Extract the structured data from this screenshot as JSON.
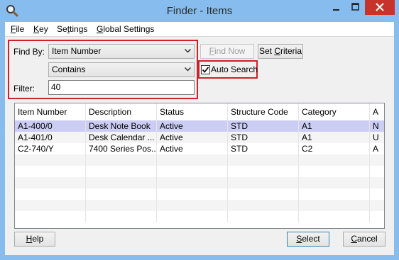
{
  "window": {
    "title": "Finder - Items"
  },
  "menu": [
    {
      "label": "File",
      "accel": "F",
      "rest": "ile"
    },
    {
      "label": "Key",
      "accel": "K",
      "rest": "ey"
    },
    {
      "label": "Settings",
      "pre": "Se",
      "accel": "t",
      "rest": "tings"
    },
    {
      "label": "Global Settings",
      "accel": "G",
      "rest": "lobal Settings"
    }
  ],
  "find": {
    "find_by_label": "Find By:",
    "find_by_value": "Item Number",
    "operator_value": "Contains",
    "filter_label": "Filter:",
    "filter_value": "40"
  },
  "buttons": {
    "find_now": {
      "accel": "F",
      "rest": "ind Now"
    },
    "set_criteria": {
      "pre": "Set ",
      "accel": "C",
      "rest": "riteria"
    },
    "help": {
      "accel": "H",
      "rest": "elp"
    },
    "select": {
      "pre": "",
      "accel": "S",
      "rest": "elect"
    },
    "cancel": {
      "pre": "",
      "accel": "C",
      "rest": "ancel"
    }
  },
  "auto_search": {
    "accel": "A",
    "rest": "uto Search",
    "checked": true
  },
  "grid": {
    "columns": [
      "Item Number",
      "Description",
      "Status",
      "Structure Code",
      "Category",
      "A"
    ],
    "rows": [
      [
        "A1-400/0",
        "Desk Note Book",
        "Active",
        "STD",
        "A1",
        "N"
      ],
      [
        "A1-401/0",
        "Desk Calendar ...",
        "Active",
        "STD",
        "A1",
        "U"
      ],
      [
        "C2-740/Y",
        "7400 Series Pos...",
        "Active",
        "STD",
        "C2",
        "A"
      ]
    ],
    "selected_row": 0
  },
  "colors": {
    "title_bar": "#86bdee",
    "highlight_box": "#d0202a",
    "selected_row": "#cbcdf5"
  }
}
